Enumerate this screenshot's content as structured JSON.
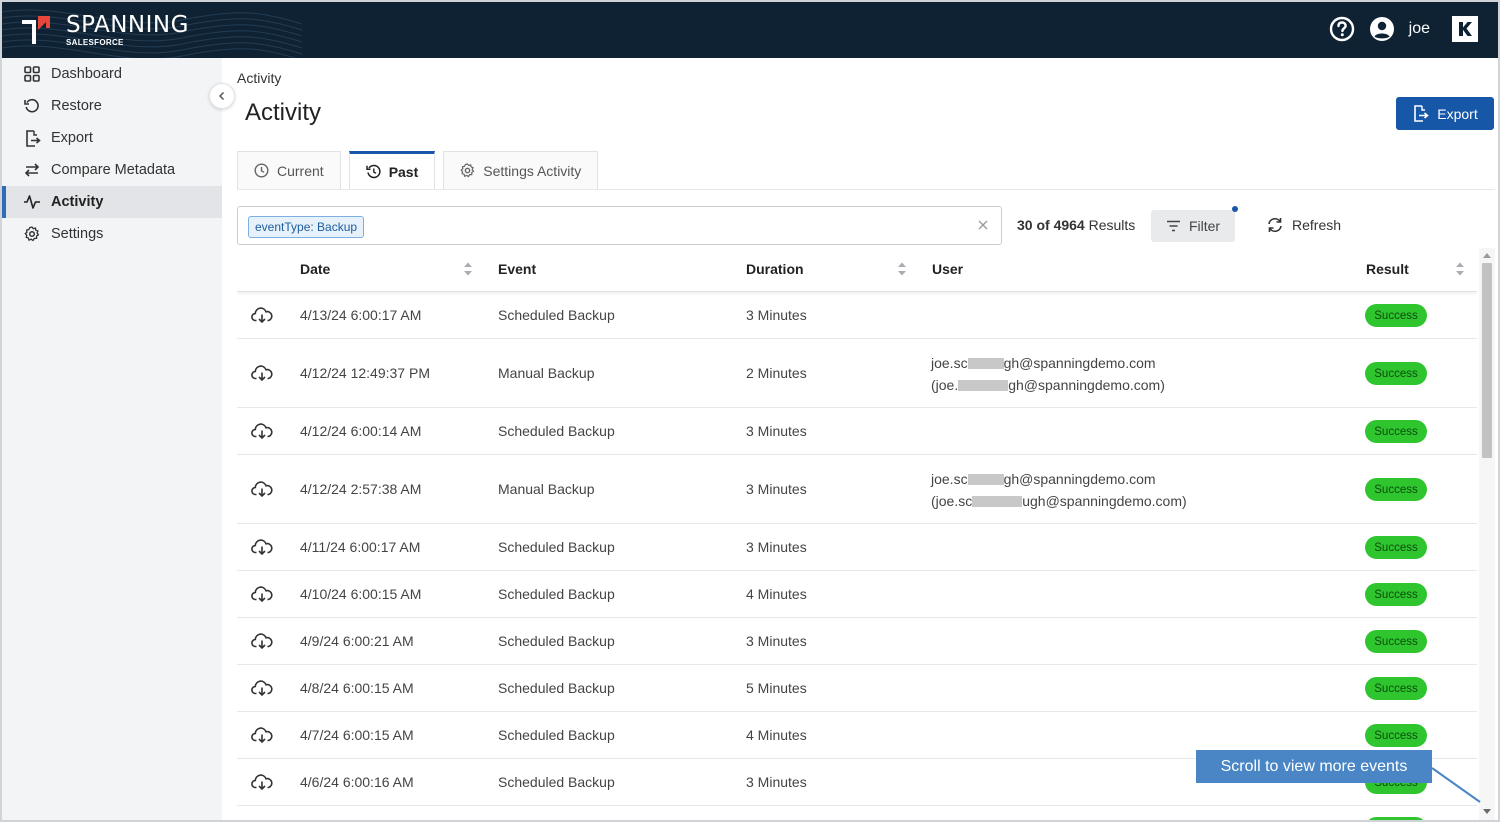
{
  "header": {
    "brand": "SPANNING",
    "brand_sub": "SALESFORCE",
    "user": "joe",
    "help_icon": "help-circle-icon",
    "avatar_icon": "user-avatar-icon",
    "app_switcher_icon": "kaseya-k-icon",
    "colors": {
      "topbar": "#0f2233",
      "accent": "#1657a8",
      "logo_red": "#e8483c"
    }
  },
  "sidebar": {
    "items": [
      {
        "label": "Dashboard",
        "icon": "grid-icon",
        "active": false
      },
      {
        "label": "Restore",
        "icon": "restore-icon",
        "active": false
      },
      {
        "label": "Export",
        "icon": "export-icon",
        "active": false
      },
      {
        "label": "Compare Metadata",
        "icon": "compare-arrows-icon",
        "active": false
      },
      {
        "label": "Activity",
        "icon": "activity-pulse-icon",
        "active": true
      },
      {
        "label": "Settings",
        "icon": "gear-icon",
        "active": false
      }
    ]
  },
  "page": {
    "breadcrumb": "Activity",
    "title": "Activity",
    "export_label": "Export"
  },
  "tabs": [
    {
      "label": "Current",
      "icon": "clock-icon",
      "active": false
    },
    {
      "label": "Past",
      "icon": "history-icon",
      "active": true
    },
    {
      "label": "Settings Activity",
      "icon": "gear-icon",
      "active": false
    }
  ],
  "toolbar": {
    "filter_chip": "eventType: Backup",
    "results_count": "30 of 4964",
    "results_label": "Results",
    "filter_label": "Filter",
    "refresh_label": "Refresh"
  },
  "table": {
    "columns": [
      "Date",
      "Event",
      "Duration",
      "User",
      "Result"
    ],
    "rows": [
      {
        "date": "4/13/24 6:00:17 AM",
        "event": "Scheduled Backup",
        "duration": "3 Minutes",
        "user": [],
        "result": "Success"
      },
      {
        "date": "4/12/24 12:49:37 PM",
        "event": "Manual Backup",
        "duration": "2 Minutes",
        "user": [
          [
            "joe.sc",
            "gh@spanningdemo.com"
          ],
          [
            "(joe.",
            "gh@spanningdemo.com)"
          ]
        ],
        "result": "Success"
      },
      {
        "date": "4/12/24 6:00:14 AM",
        "event": "Scheduled Backup",
        "duration": "3 Minutes",
        "user": [],
        "result": "Success"
      },
      {
        "date": "4/12/24 2:57:38 AM",
        "event": "Manual Backup",
        "duration": "3 Minutes",
        "user": [
          [
            "joe.sc",
            "gh@spanningdemo.com"
          ],
          [
            "(joe.sc",
            "ugh@spanningdemo.com)"
          ]
        ],
        "result": "Success"
      },
      {
        "date": "4/11/24 6:00:17 AM",
        "event": "Scheduled Backup",
        "duration": "3 Minutes",
        "user": [],
        "result": "Success"
      },
      {
        "date": "4/10/24 6:00:15 AM",
        "event": "Scheduled Backup",
        "duration": "4 Minutes",
        "user": [],
        "result": "Success"
      },
      {
        "date": "4/9/24 6:00:21 AM",
        "event": "Scheduled Backup",
        "duration": "3 Minutes",
        "user": [],
        "result": "Success"
      },
      {
        "date": "4/8/24 6:00:15 AM",
        "event": "Scheduled Backup",
        "duration": "5 Minutes",
        "user": [],
        "result": "Success"
      },
      {
        "date": "4/7/24 6:00:15 AM",
        "event": "Scheduled Backup",
        "duration": "4 Minutes",
        "user": [],
        "result": "Success"
      },
      {
        "date": "4/6/24 6:00:16 AM",
        "event": "Scheduled Backup",
        "duration": "3 Minutes",
        "user": [],
        "result": "Success"
      }
    ]
  },
  "callout": {
    "text": "Scroll to view more events"
  }
}
